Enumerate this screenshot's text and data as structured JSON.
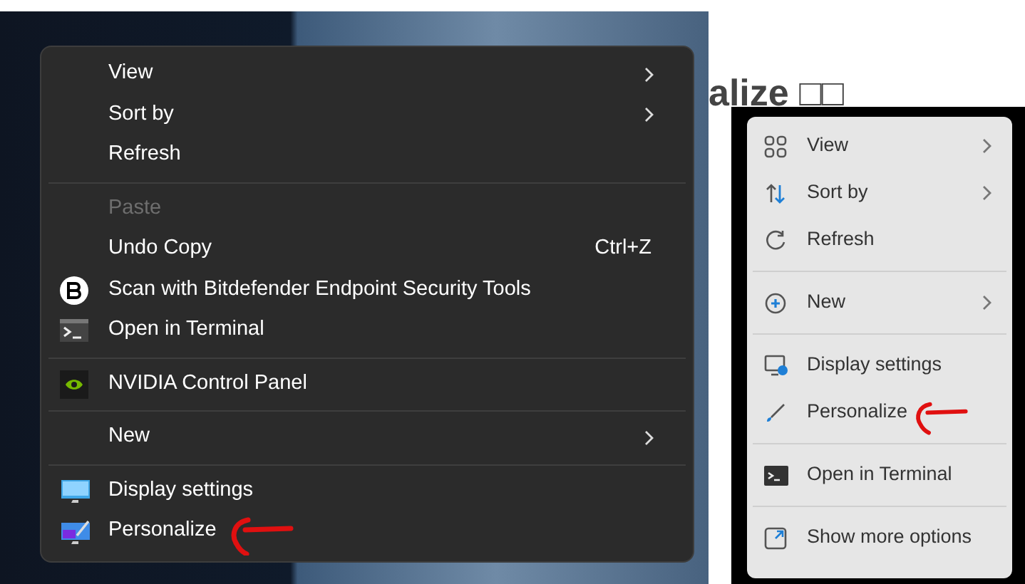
{
  "dark_menu": {
    "items": [
      {
        "kind": "item",
        "label": "View",
        "submenu": true,
        "disabled": false
      },
      {
        "kind": "item",
        "label": "Sort by",
        "submenu": true,
        "disabled": false
      },
      {
        "kind": "item",
        "label": "Refresh",
        "submenu": false,
        "disabled": false
      },
      {
        "kind": "separator"
      },
      {
        "kind": "item",
        "label": "Paste",
        "submenu": false,
        "disabled": true
      },
      {
        "kind": "item",
        "label": "Undo Copy",
        "shortcut": "Ctrl+Z",
        "submenu": false,
        "disabled": false
      },
      {
        "kind": "item",
        "label": "Scan with Bitdefender Endpoint Security Tools",
        "submenu": false,
        "disabled": false
      },
      {
        "kind": "item",
        "label": "Open in Terminal",
        "submenu": false,
        "disabled": false
      },
      {
        "kind": "separator"
      },
      {
        "kind": "item",
        "label": "NVIDIA Control Panel",
        "submenu": false,
        "disabled": false
      },
      {
        "kind": "separator"
      },
      {
        "kind": "item",
        "label": "New",
        "submenu": true,
        "disabled": false
      },
      {
        "kind": "separator"
      },
      {
        "kind": "item",
        "label": "Display settings",
        "submenu": false,
        "disabled": false
      },
      {
        "kind": "item",
        "label": "Personalize",
        "submenu": false,
        "disabled": false,
        "annotated": true
      }
    ]
  },
  "heading": "alize □□",
  "light_menu": {
    "items": [
      {
        "kind": "item",
        "label": "View",
        "submenu": true
      },
      {
        "kind": "item",
        "label": "Sort by",
        "submenu": true
      },
      {
        "kind": "item",
        "label": "Refresh",
        "submenu": false
      },
      {
        "kind": "separator"
      },
      {
        "kind": "item",
        "label": "New",
        "submenu": true
      },
      {
        "kind": "separator"
      },
      {
        "kind": "item",
        "label": "Display settings",
        "submenu": false
      },
      {
        "kind": "item",
        "label": "Personalize",
        "submenu": false,
        "annotated": true
      },
      {
        "kind": "separator"
      },
      {
        "kind": "item",
        "label": "Open in Terminal",
        "submenu": false
      },
      {
        "kind": "separator"
      },
      {
        "kind": "item",
        "label": "Show more options",
        "submenu": false
      }
    ]
  }
}
